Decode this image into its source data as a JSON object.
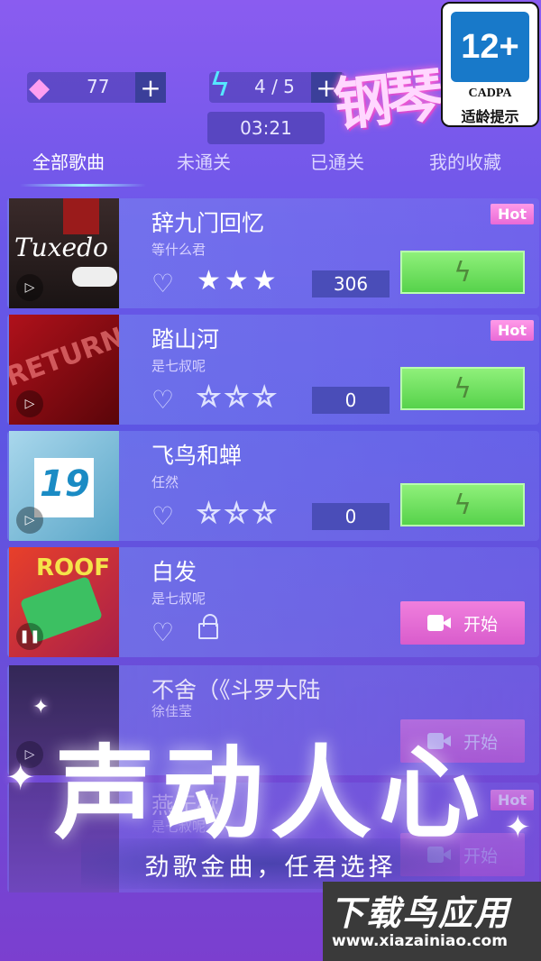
{
  "header": {
    "gems": "77",
    "energy": "4 / 5",
    "timer": "03:21",
    "plus_gem": "+",
    "plus_energy": "+",
    "logo_text": "钢琴"
  },
  "rating_badge": {
    "age": "12+",
    "org": "CADPA",
    "label": "适龄提示"
  },
  "tabs": [
    {
      "label": "全部歌曲"
    },
    {
      "label": "未通关"
    },
    {
      "label": "已通关"
    },
    {
      "label": "我的收藏"
    }
  ],
  "songs": [
    {
      "title": "辞九门回忆",
      "artist": "等什么君",
      "score": "306",
      "hot": "Hot",
      "stars": "★★★",
      "cover_text": "Tuxedo"
    },
    {
      "title": "踏山河",
      "artist": "是七叔呢",
      "score": "0",
      "hot": "Hot",
      "stars": "☆☆☆",
      "cover_text": "RETURN"
    },
    {
      "title": "飞鸟和蝉",
      "artist": "任然",
      "score": "0",
      "stars": "☆☆☆",
      "cover_text": "19"
    },
    {
      "title": "白发",
      "artist": "是七叔呢",
      "start_label": "开始",
      "cover_text": "ROOF"
    },
    {
      "title": "不舍（《斗罗大陆",
      "artist": "徐佳莹",
      "start_label": "开始"
    },
    {
      "title": "燕无歇",
      "artist": "是七叔呢",
      "hot": "Hot",
      "start_label": "开始"
    }
  ],
  "promo": {
    "headline": "声动人心",
    "subline": "劲歌金曲，任君选择"
  },
  "watermark": {
    "title": "下载鸟应用",
    "url": "www.xiazainiao.com"
  },
  "colors": {
    "play_green": "#6fe05c",
    "start_pink": "#e66bd5",
    "score_bg": "#4a4db8",
    "rating_blue": "#1879c9"
  }
}
